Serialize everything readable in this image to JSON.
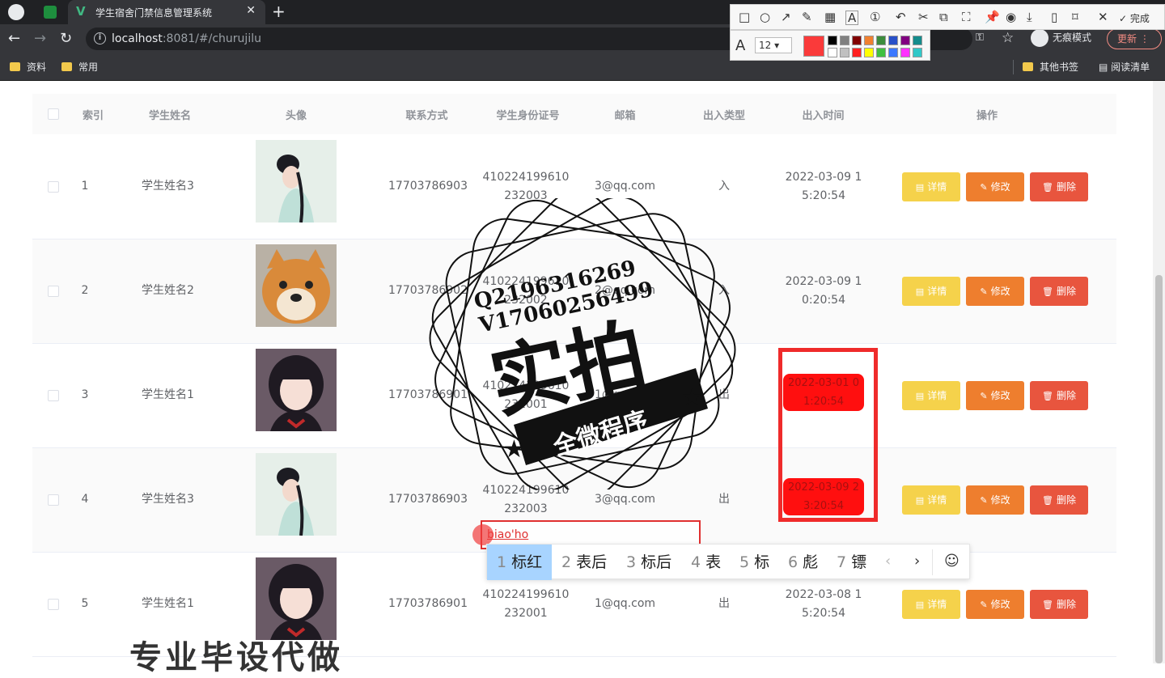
{
  "browser": {
    "tab_title": "学生宿舍门禁信息管理系统",
    "tab_close": "✕",
    "new_tab": "+",
    "url_host": "localhost",
    "url_rest": ":8081/#/churujilu",
    "incognito_label": "无痕模式",
    "update_label": "更新",
    "bookmarks": [
      "资料",
      "常用"
    ],
    "bookmarks_right": [
      "其他书签",
      "阅读清单"
    ]
  },
  "screenshot_tool": {
    "done_label": "完成",
    "font_size": "12",
    "current_color": "#fa3a3a",
    "palette": [
      "#000000",
      "#808080",
      "#800000",
      "#f08030",
      "#3c8c3c",
      "#2850c8",
      "#800080",
      "#148c8c",
      "#ffffff",
      "#c0c0c0",
      "#ff2020",
      "#ffff00",
      "#40c040",
      "#3c78ff",
      "#ff30ff",
      "#30c8c8"
    ],
    "icons": [
      "rect-icon",
      "ellipse-icon",
      "arrow-icon",
      "pen-icon",
      "mosaic-icon",
      "text-icon",
      "number-icon",
      "undo-icon",
      "cut-icon",
      "copy-icon",
      "scan-icon",
      "pin-icon",
      "record-icon",
      "download-icon",
      "phone-icon",
      "bookmark-icon",
      "close-icon"
    ]
  },
  "table": {
    "headers": [
      "索引",
      "学生姓名",
      "头像",
      "联系方式",
      "学生身份证号",
      "邮箱",
      "出入类型",
      "出入时间",
      "操作"
    ],
    "rows": [
      {
        "index": "1",
        "name": "学生姓名3",
        "phone": "17703786903",
        "id_line1": "410224199610",
        "id_line2": "232003",
        "email": "3@qq.com",
        "type": "入",
        "time_line1": "2022-03-09 1",
        "time_line2": "5:20:54",
        "avatar": "avatar-girl-blue"
      },
      {
        "index": "2",
        "name": "学生姓名2",
        "phone": "17703786902",
        "id_line1": "410224199610",
        "id_line2": "232002",
        "email": "2@qq.com",
        "type": "入",
        "time_line1": "2022-03-09 1",
        "time_line2": "0:20:54",
        "avatar": "avatar-shiba"
      },
      {
        "index": "3",
        "name": "学生姓名1",
        "phone": "17703786901",
        "id_line1": "410224199610",
        "id_line2": "232001",
        "email": "1@qq.com",
        "type": "出",
        "time_line1": "2022-03-01 0",
        "time_line2": "1:20:54",
        "avatar": "avatar-girl-dark"
      },
      {
        "index": "4",
        "name": "学生姓名3",
        "phone": "17703786903",
        "id_line1": "410224199610",
        "id_line2": "232003",
        "email": "3@qq.com",
        "type": "出",
        "time_line1": "2022-03-09 2",
        "time_line2": "3:20:54",
        "avatar": "avatar-girl-blue"
      },
      {
        "index": "5",
        "name": "学生姓名1",
        "phone": "17703786901",
        "id_line1": "410224199610",
        "id_line2": "232001",
        "email": "1@qq.com",
        "type": "出",
        "time_line1": "2022-03-08 1",
        "time_line2": "5:20:54",
        "avatar": "avatar-girl-dark"
      }
    ],
    "buttons": {
      "detail": "详情",
      "edit": "修改",
      "delete": "删除"
    }
  },
  "annotation": {
    "text_input_value": "biao'ho"
  },
  "ime": {
    "candidates": [
      {
        "n": "1",
        "text": "标红"
      },
      {
        "n": "2",
        "text": "表后"
      },
      {
        "n": "3",
        "text": "标后"
      },
      {
        "n": "4",
        "text": "表"
      },
      {
        "n": "5",
        "text": "标"
      },
      {
        "n": "6",
        "text": "彪"
      },
      {
        "n": "7",
        "text": "镖"
      }
    ],
    "prev": "‹",
    "next": "›",
    "emoji": "☺"
  },
  "watermark": {
    "qq": "Q2196316269",
    "vx": "V17060256499",
    "big": "实拍",
    "banner": "全微程序",
    "bottom": "专业毕设代做"
  }
}
